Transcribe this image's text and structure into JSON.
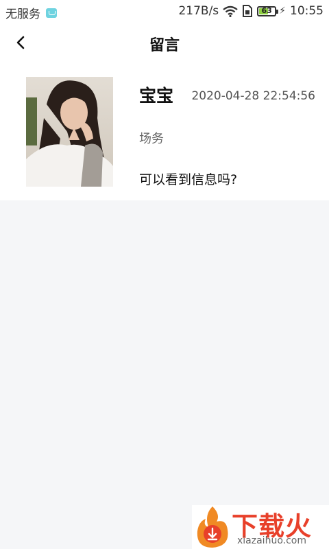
{
  "status_bar": {
    "carrier": "无服务",
    "net_speed": "217B/s",
    "battery_level": "63",
    "battery_fraction": 0.63,
    "time": "10:55"
  },
  "header": {
    "title": "留言"
  },
  "message": {
    "sender_name": "宝宝",
    "time": "2020-04-28 22:54:56",
    "tag": "场务",
    "text": "可以看到信息吗?"
  },
  "watermark": {
    "text": "下载火",
    "subtext": "xiazaihuo.com"
  },
  "colors": {
    "background": "#f5f6f8",
    "card": "#ffffff",
    "accent": "#e8402a",
    "battery": "#8fd142"
  }
}
